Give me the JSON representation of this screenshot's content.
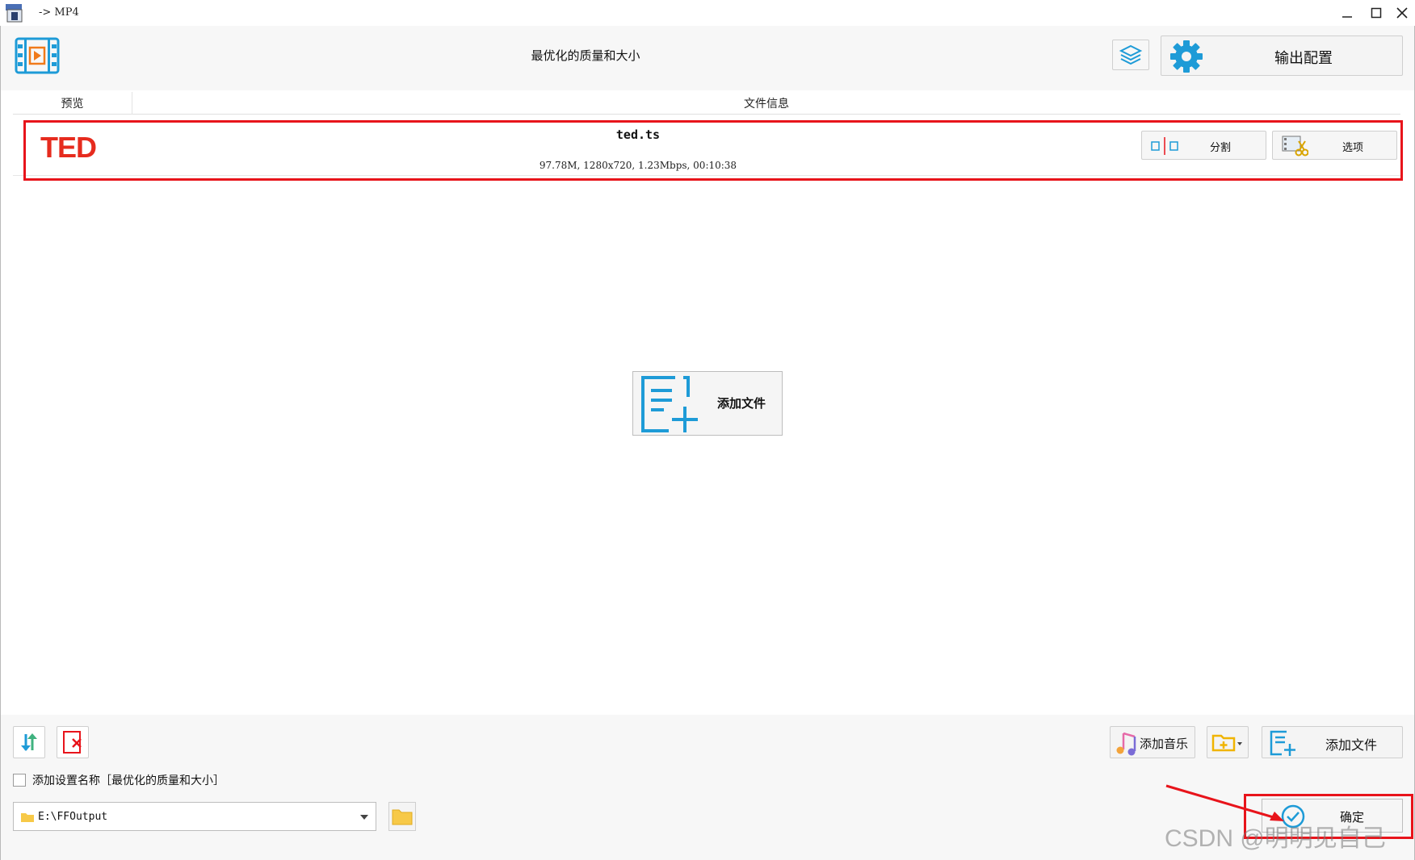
{
  "window": {
    "title": "-> MP4"
  },
  "header": {
    "profile_title": "最优化的质量和大小",
    "output_config_label": "输出配置"
  },
  "columns": {
    "preview": "预览",
    "file_info": "文件信息"
  },
  "file": {
    "name": "ted.ts",
    "meta": "97.78M,  1280x720,  1.23Mbps,  00:10:38",
    "thumbnail_text": "TED",
    "split_label": "分割",
    "options_label": "选项"
  },
  "center": {
    "add_file_label": "添加文件"
  },
  "toolbar": {
    "add_music_label": "添加音乐",
    "add_file_label": "添加文件"
  },
  "settings": {
    "add_name_label": "添加设置名称［最优化的质量和大小］",
    "add_name_checked": false
  },
  "output_path": "E:\\FFOutput",
  "ok_label": "确定",
  "watermark": "CSDN @明明见自己",
  "colors": {
    "accent": "#1e9bd7",
    "highlight": "#e8141b",
    "ted_red": "#e62b1e"
  }
}
